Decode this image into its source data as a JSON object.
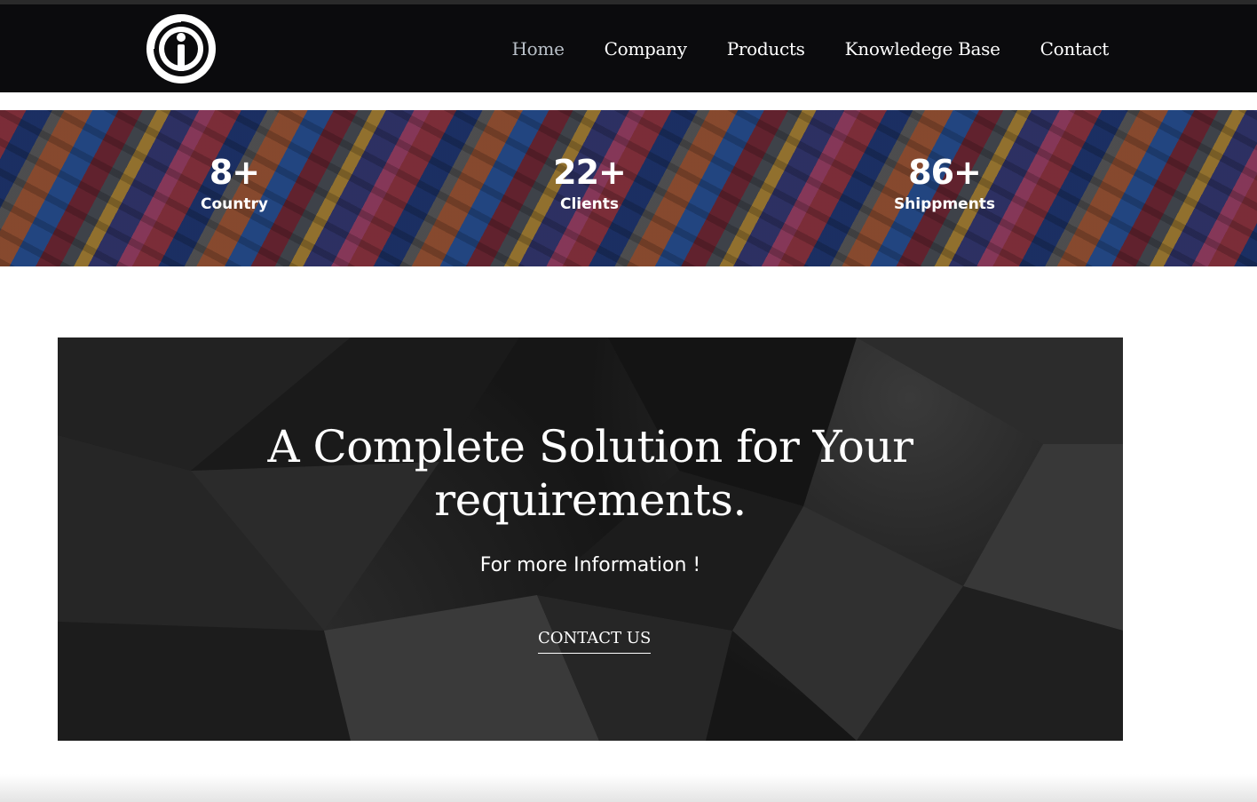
{
  "header": {
    "logo_icon": "info-circle-logo-icon",
    "nav": [
      {
        "label": "Home",
        "active": true
      },
      {
        "label": "Company",
        "active": false
      },
      {
        "label": "Products",
        "active": false
      },
      {
        "label": "Knowledege Base",
        "active": false
      },
      {
        "label": "Contact",
        "active": false
      }
    ]
  },
  "stats": [
    {
      "value": "8+",
      "label": "Country"
    },
    {
      "value": "22+",
      "label": "Clients"
    },
    {
      "value": "86+",
      "label": "Shippments"
    }
  ],
  "cta": {
    "title_line1": "A Complete Solution for Your",
    "title_line2": "requirements.",
    "subtitle": "For more Information !",
    "button_label": "CONTACT US"
  },
  "colors": {
    "nav_background": "#0b0b0d",
    "active_nav": "#b9c0c8",
    "cta_background": "#161616"
  }
}
